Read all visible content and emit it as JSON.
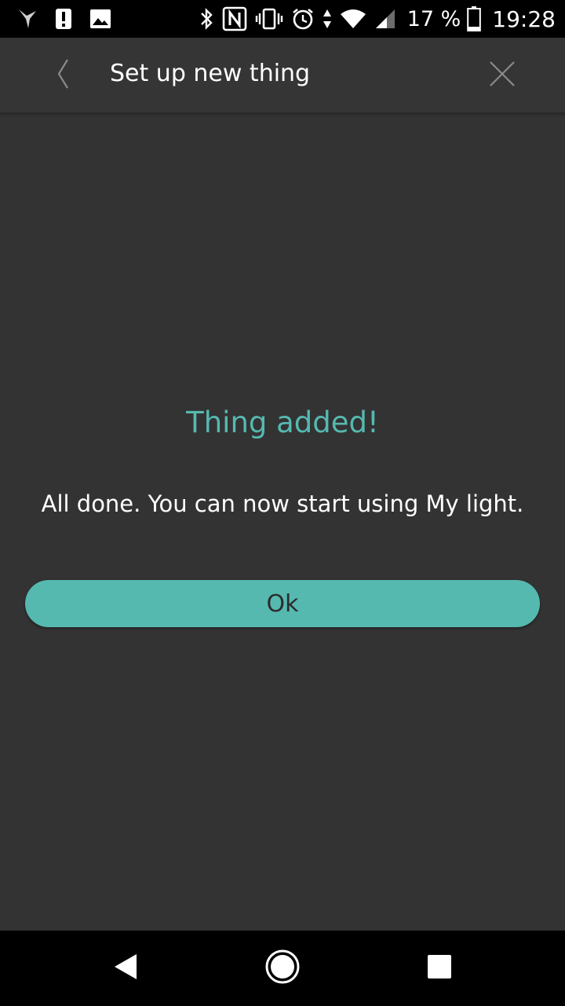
{
  "status_bar": {
    "left_icons": [
      "bird-notification-icon",
      "alert-notification-icon",
      "image-notification-icon"
    ],
    "right_icons": [
      "bluetooth-icon",
      "nfc-icon",
      "vibrate-icon",
      "alarm-icon",
      "data-arrows-icon",
      "wifi-icon",
      "cell-signal-icon"
    ],
    "battery_percent": "17 %",
    "battery_level": 0.17,
    "time": "19:28"
  },
  "header": {
    "title": "Set up new thing",
    "back_icon": "chevron-left-icon",
    "close_icon": "close-icon"
  },
  "content": {
    "title": "Thing added!",
    "message": "All done. You can now start using My light.",
    "ok_label": "Ok"
  },
  "nav_bar": {
    "icons": [
      "back-triangle-icon",
      "home-circle-icon",
      "recents-square-icon"
    ]
  },
  "colors": {
    "accent": "#56b9b0",
    "background": "#333333",
    "header": "#353535",
    "system_bars": "#000000"
  }
}
